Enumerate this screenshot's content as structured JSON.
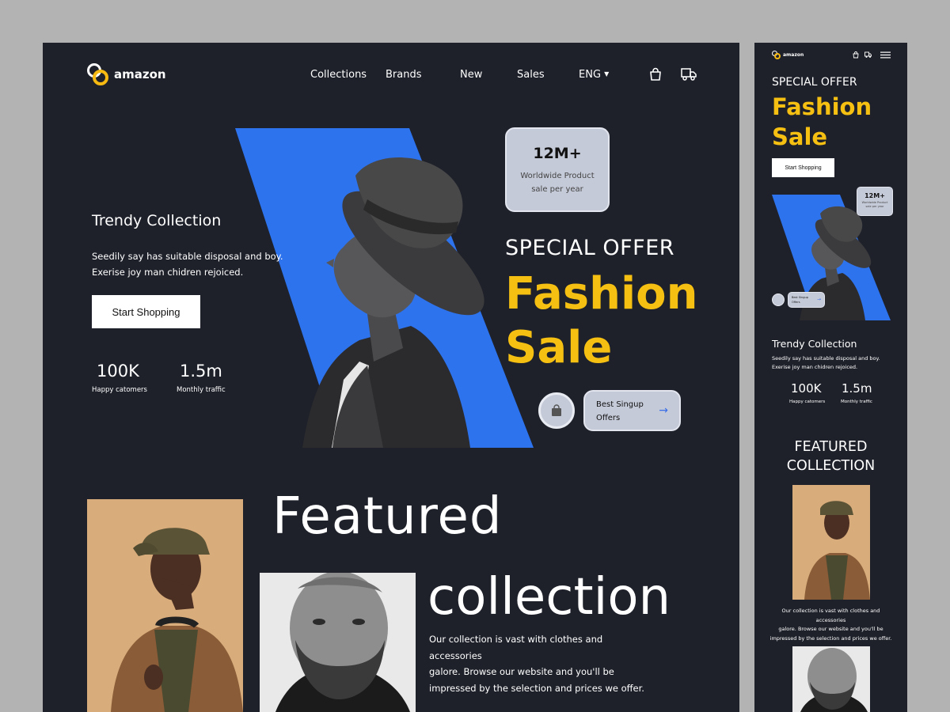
{
  "brand": {
    "name": "amazon",
    "accent": "#f6b912",
    "blue": "#2e73ee",
    "bg": "#1e212a"
  },
  "nav": {
    "collections": "Collections",
    "brands": "Brands",
    "new": "New",
    "sales": "Sales",
    "language": "ENG"
  },
  "hero": {
    "subtitle": "Trendy Collection",
    "desc_line1": "Seedily say has suitable disposal and boy.",
    "desc_line2": "Exerise joy man chidren rejoiced.",
    "cta": "Start Shopping",
    "stats": [
      {
        "value": "100K",
        "label": "Happy catomers"
      },
      {
        "value": "1.5m",
        "label": "Monthly traffic"
      }
    ],
    "card": {
      "value": "12M+",
      "line1": "Worldwide Product",
      "line2": "sale per year"
    },
    "special": "SPECIAL OFFER",
    "fashion": "Fashion",
    "sale": "Sale",
    "signup": {
      "line1": "Best Singup",
      "line2": "Offers",
      "arrow": "→"
    }
  },
  "featured": {
    "word1": "Featured",
    "word2": "collection",
    "desc_line1": "Our collection is vast with clothes and accessories",
    "desc_line2": "galore. Browse our website and you'll be",
    "desc_line3": "impressed by the selection and prices we offer.",
    "mobile_title_line1": "FEATURED",
    "mobile_title_line2": "COLLECTION"
  },
  "icons": {
    "dropdown": "caret-down-icon",
    "cart": "shopping-bag-icon",
    "delivery": "truck-icon",
    "menu": "hamburger-menu-icon"
  }
}
